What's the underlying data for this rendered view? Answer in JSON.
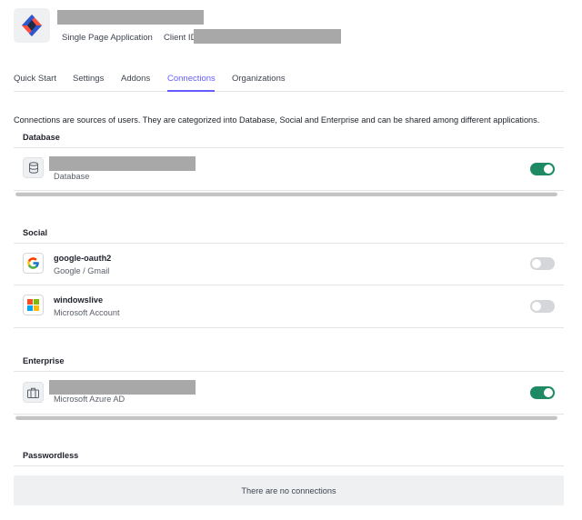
{
  "app": {
    "type_label": "Single Page Application",
    "client_id_label": "Client ID"
  },
  "tabs": [
    {
      "label": "Quick Start",
      "active": false
    },
    {
      "label": "Settings",
      "active": false
    },
    {
      "label": "Addons",
      "active": false
    },
    {
      "label": "Connections",
      "active": true
    },
    {
      "label": "Organizations",
      "active": false
    }
  ],
  "intro_text": "Connections are sources of users. They are categorized into Database, Social and Enterprise and can be shared among different applications.",
  "sections": {
    "database": {
      "title": "Database",
      "items": [
        {
          "subtitle": "Database",
          "icon": "database-icon",
          "enabled": true
        }
      ]
    },
    "social": {
      "title": "Social",
      "items": [
        {
          "name": "google-oauth2",
          "subtitle": "Google / Gmail",
          "icon": "google-icon",
          "enabled": false
        },
        {
          "name": "windowslive",
          "subtitle": "Microsoft Account",
          "icon": "microsoft-icon",
          "enabled": false
        }
      ]
    },
    "enterprise": {
      "title": "Enterprise",
      "items": [
        {
          "subtitle": "Microsoft Azure AD",
          "icon": "briefcase-icon",
          "enabled": true
        }
      ]
    },
    "passwordless": {
      "title": "Passwordless",
      "empty_text": "There are no connections"
    }
  },
  "colors": {
    "accent": "#635dff",
    "toggle_on": "#1e8a64",
    "toggle_off": "#d4d6da"
  }
}
